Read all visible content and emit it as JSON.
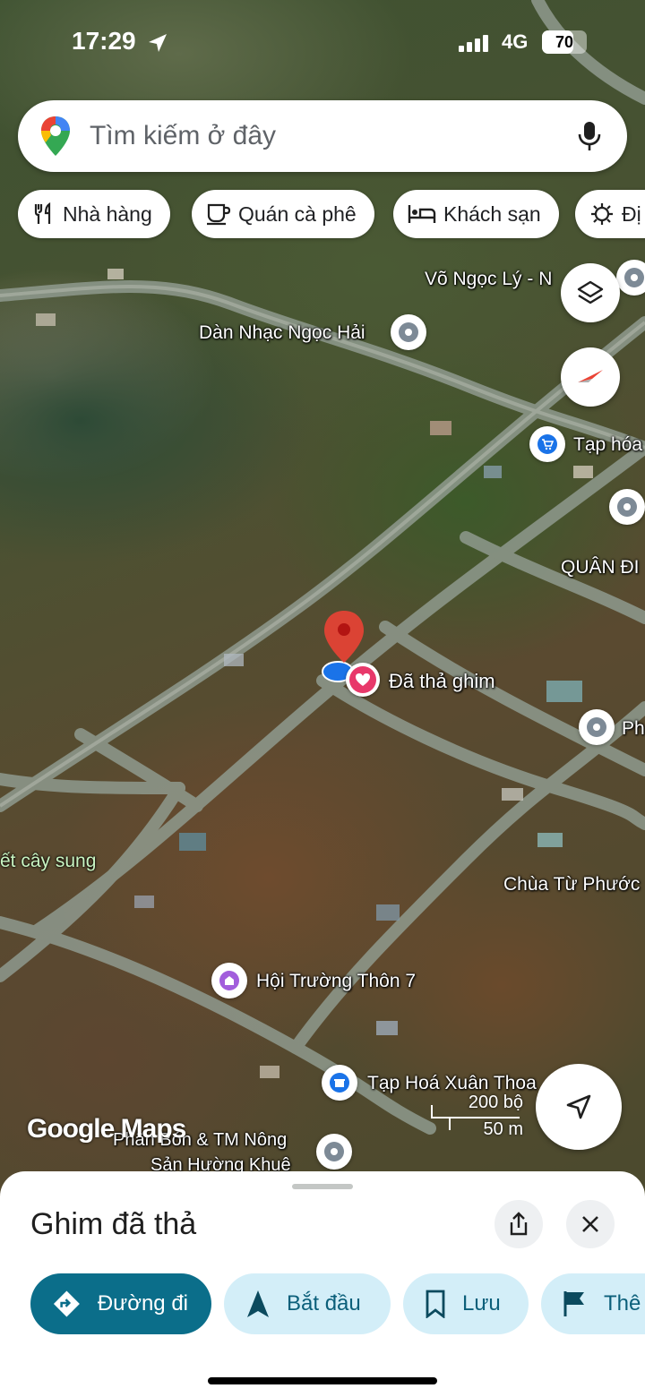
{
  "status_bar": {
    "time": "17:29",
    "network": "4G",
    "battery": "70"
  },
  "search": {
    "placeholder": "Tìm kiếm ở đây"
  },
  "chips": [
    {
      "label": "Nhà hàng",
      "icon": "restaurant-icon"
    },
    {
      "label": "Quán cà phê",
      "icon": "coffee-icon"
    },
    {
      "label": "Khách sạn",
      "icon": "hotel-icon"
    },
    {
      "label": "Đị",
      "icon": "attraction-icon"
    }
  ],
  "map": {
    "labels": {
      "vo_ngoc_ly": "Võ Ngọc Lý - N",
      "dan_nhac": "Dàn Nhạc Ngọc Hải",
      "tap_hoa": "Tạp hóa",
      "quan_doi": "QUÂN ĐI",
      "dropped_pin": "Đã thả ghim",
      "ph": "Ph",
      "cay_sung": "ết cây sung",
      "chua": "Chùa Từ Phước",
      "hoi_truong": "Hội Trường Thôn 7",
      "tap_hoa_xuan": "Tạp Hoá Xuân Thoa",
      "phan_bon_1": "Phân Bón & TM Nông",
      "phan_bon_2": "Sản Hường Khuê"
    },
    "watermark": "Google Maps",
    "scale": {
      "imperial": "200 bộ",
      "metric": "50 m"
    }
  },
  "sheet": {
    "title": "Ghim đã thả",
    "actions": [
      {
        "label": "Đường đi",
        "icon": "directions-icon"
      },
      {
        "label": "Bắt đầu",
        "icon": "navigation-start-icon"
      },
      {
        "label": "Lưu",
        "icon": "bookmark-icon"
      },
      {
        "label": "Thê",
        "icon": "flag-icon"
      }
    ]
  },
  "colors": {
    "accent": "#0b6e8a",
    "action_bg": "#d3eef8",
    "pin_red": "#ea4335",
    "location_blue": "#1a73e8"
  }
}
